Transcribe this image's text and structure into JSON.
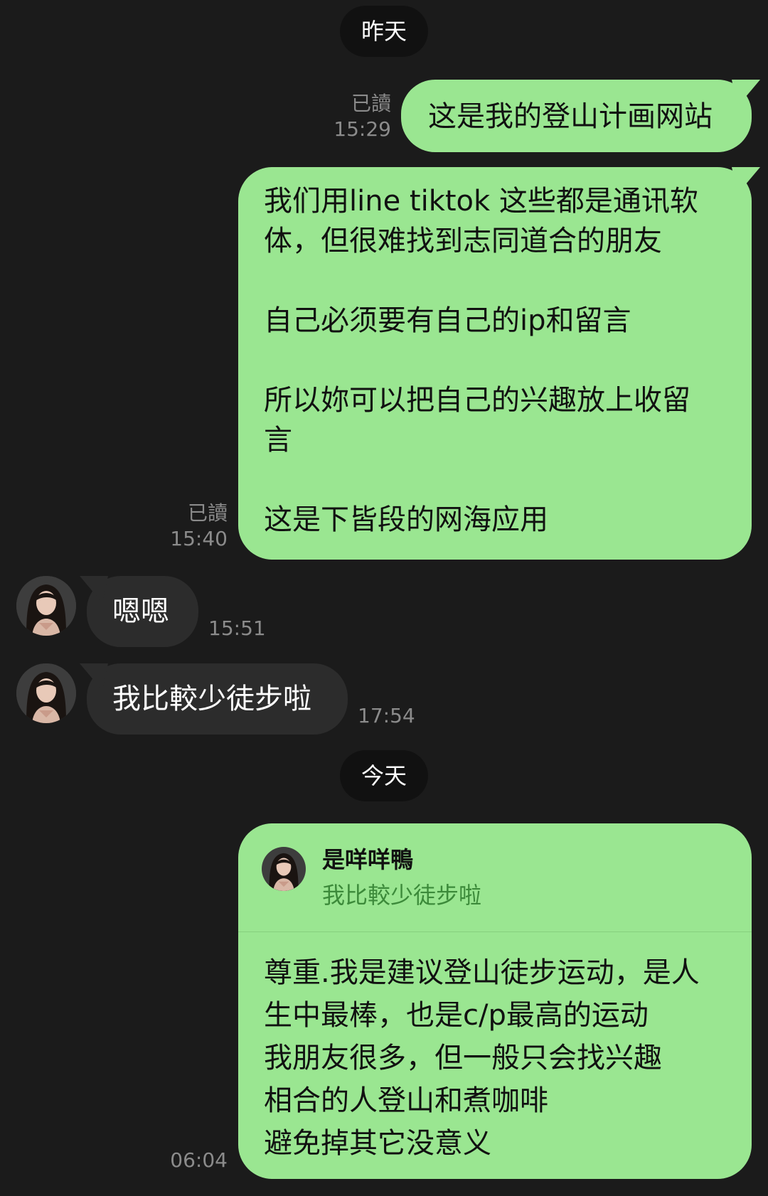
{
  "dates": {
    "yesterday": "昨天",
    "today": "今天"
  },
  "messages": [
    {
      "direction": "out",
      "text": "这是我的登山计画网站",
      "read_label": "已讀",
      "time": "15:29"
    },
    {
      "direction": "out",
      "text": "我们用line tiktok 这些都是通讯软\n体，但很难找到志同道合的朋友\n\n自己必须要有自己的ip和留言\n\n所以妳可以把自己的兴趣放上收留\n言\n\n这是下皆段的网海应用",
      "read_label": "已讀",
      "time": "15:40"
    },
    {
      "direction": "in",
      "text": "嗯嗯",
      "time": "15:51",
      "avatar": "contact-avatar-icon"
    },
    {
      "direction": "in",
      "text": "我比較少徒步啦",
      "time": "17:54",
      "avatar": "contact-avatar-icon"
    },
    {
      "direction": "out",
      "reply": {
        "name": "是咩咩鴨",
        "quoted_text": "我比較少徒步啦",
        "avatar": "contact-avatar-icon"
      },
      "text": "尊重.我是建议登山徒步运动，是人\n生中最棒，也是c/p最高的运动\n我朋友很多，但一般只会找兴趣\n相合的人登山和煮咖啡\n避免掉其它没意义",
      "time": "06:04"
    }
  ],
  "colors": {
    "background": "#1b1b1b",
    "outgoing_bubble": "#9ae691",
    "incoming_bubble": "#2c2c2c",
    "date_pill": "#111111",
    "meta_text": "#8b8b8b",
    "reply_quote_text": "#3c8a3a"
  }
}
